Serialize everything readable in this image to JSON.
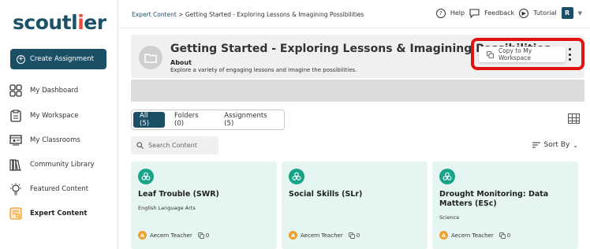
{
  "app": {
    "logo_pre": "scoutl",
    "logo_dot": "i",
    "logo_post": "er"
  },
  "sidebar": {
    "create_label": "Create Assignment",
    "items": [
      {
        "label": "My Dashboard"
      },
      {
        "label": "My Workspace"
      },
      {
        "label": "My Classrooms"
      },
      {
        "label": "Community Library"
      },
      {
        "label": "Featured Content"
      },
      {
        "label": "Expert Content"
      }
    ]
  },
  "topbar": {
    "crumb_link": "Expert Content",
    "crumb_rest": " > Getting Started - Exploring Lessons & Imagining Possibilities",
    "help": "Help",
    "feedback": "Feedback",
    "tutorial": "Tutorial",
    "avatar": "R"
  },
  "header": {
    "title": "Getting Started - Exploring Lessons & Imagining Possibilities",
    "about": "About",
    "description": "Explore a variety of engaging lessons and imagine the possibilities.",
    "copy_label": "Copy to My Workspace"
  },
  "tabs": [
    {
      "label": "All (5)"
    },
    {
      "label": "Folders (0)"
    },
    {
      "label": "Assignments (5)"
    }
  ],
  "search": {
    "placeholder": "Search Content"
  },
  "sort_label": "Sort By",
  "cards": [
    {
      "title": "Leaf Trouble (SWR)",
      "subject": "English Language Arts",
      "author": "Aecern Teacher",
      "author_initial": "A",
      "copies": "0"
    },
    {
      "title": "Social Skills (SLr)",
      "subject": "",
      "author": "Aecern Teacher",
      "author_initial": "A",
      "copies": "0"
    },
    {
      "title": "Drought Monitoring: Data Matters (ESc)",
      "subject": "Science",
      "author": "Aecern Teacher",
      "author_initial": "A",
      "copies": "0"
    }
  ],
  "colors": {
    "brand": "#1b4f66",
    "accent_red": "#e31212",
    "card_bg": "#e4f5f2",
    "card_icon": "#17a589"
  }
}
